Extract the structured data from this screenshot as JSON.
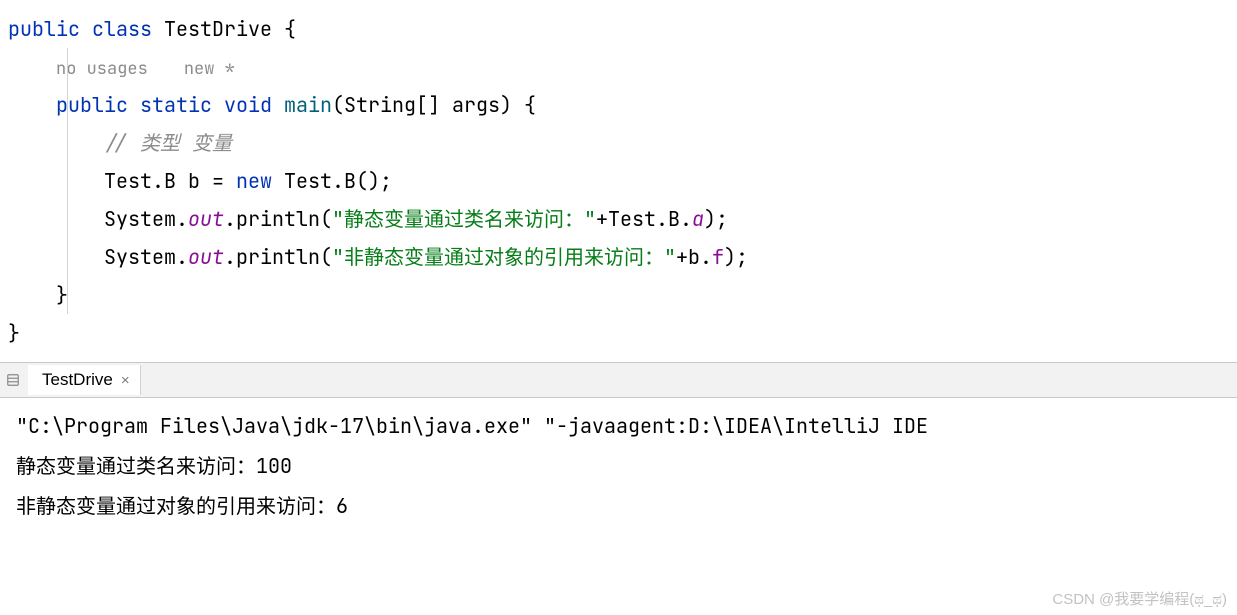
{
  "code": {
    "line1": {
      "kw_public": "public",
      "kw_class": "class",
      "class_name": "TestDrive",
      "brace": " {"
    },
    "hints": {
      "no_usages": "no usages",
      "new_star": "new *"
    },
    "line2": {
      "kw_public": "public",
      "kw_static": "static",
      "kw_void": "void",
      "method": "main",
      "params": "(String[] args) {"
    },
    "comment": "// 类型 变量",
    "line3": {
      "type": "Test.B b = ",
      "kw_new": "new",
      "ctor": " Test.B();"
    },
    "line4": {
      "prefix": "System.",
      "out": "out",
      "mid": ".println(",
      "str": "\"静态变量通过类名来访问：\"",
      "plus": "+Test.B.",
      "field": "a",
      "end": ");"
    },
    "line5": {
      "prefix": "System.",
      "out": "out",
      "mid": ".println(",
      "str": "\"非静态变量通过对象的引用来访问：\"",
      "plus": "+b.",
      "field": "f",
      "end": ");"
    },
    "close_inner": "}",
    "close_outer": "}"
  },
  "tab": {
    "name": "TestDrive",
    "close": "×"
  },
  "console": {
    "cmd": "\"C:\\Program Files\\Java\\jdk-17\\bin\\java.exe\" \"-javaagent:D:\\IDEA\\IntelliJ IDE",
    "out1": "静态变量通过类名来访问：100",
    "out2": "非静态变量通过对象的引用来访问：6"
  },
  "watermark": "CSDN @我要学编程(ಥ_ಥ)"
}
